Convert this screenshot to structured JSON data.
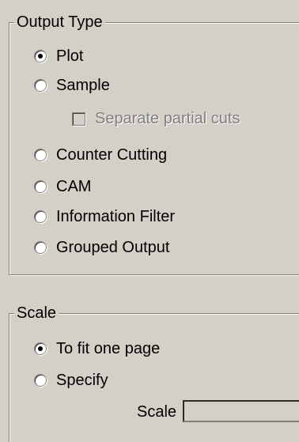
{
  "output_type": {
    "title": "Output Type",
    "options": [
      {
        "label": "Plot",
        "selected": true
      },
      {
        "label": "Sample",
        "selected": false
      },
      {
        "label": "Counter Cutting",
        "selected": false
      },
      {
        "label": "CAM",
        "selected": false
      },
      {
        "label": "Information Filter",
        "selected": false
      },
      {
        "label": "Grouped Output",
        "selected": false
      }
    ],
    "separate_partial_cuts": {
      "label": "Separate partial cuts",
      "checked": false,
      "enabled": false
    }
  },
  "scale": {
    "title": "Scale",
    "options": [
      {
        "label": "To fit one page",
        "selected": true
      },
      {
        "label": "Specify",
        "selected": false
      }
    ],
    "field_label": "Scale",
    "field_value": ""
  }
}
